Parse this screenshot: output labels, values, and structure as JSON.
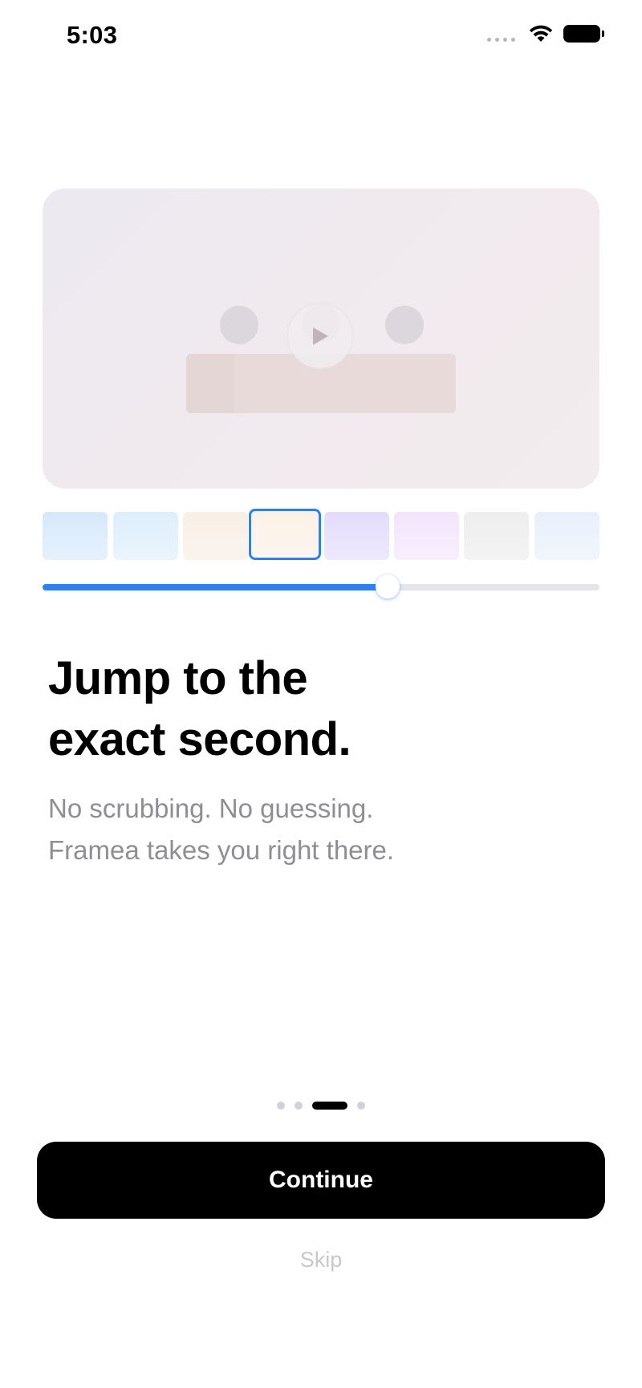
{
  "status_bar": {
    "time": "5:03",
    "icons": [
      "cellular-signal-icon",
      "wifi-icon",
      "battery-icon"
    ]
  },
  "preview": {
    "icons": [
      "play-icon"
    ]
  },
  "timeline": {
    "thumbnail_count": 8,
    "selected_thumbnail_index": 3,
    "scrub_progress": 0.62
  },
  "onboarding": {
    "headline_line1": "Jump to the",
    "headline_line2": "exact second.",
    "subtitle_line1": "No scrubbing. No guessing.",
    "subtitle_line2": "Framea takes you right there."
  },
  "pager": {
    "page_count": 4,
    "current_page": 3
  },
  "actions": {
    "continue_label": "Continue",
    "skip_label": "Skip"
  },
  "colors": {
    "accent": "#2f7ff0",
    "primary_button": "#000000",
    "subtitle_text": "#8e8e93",
    "skip_text": "#c7c7cc"
  }
}
